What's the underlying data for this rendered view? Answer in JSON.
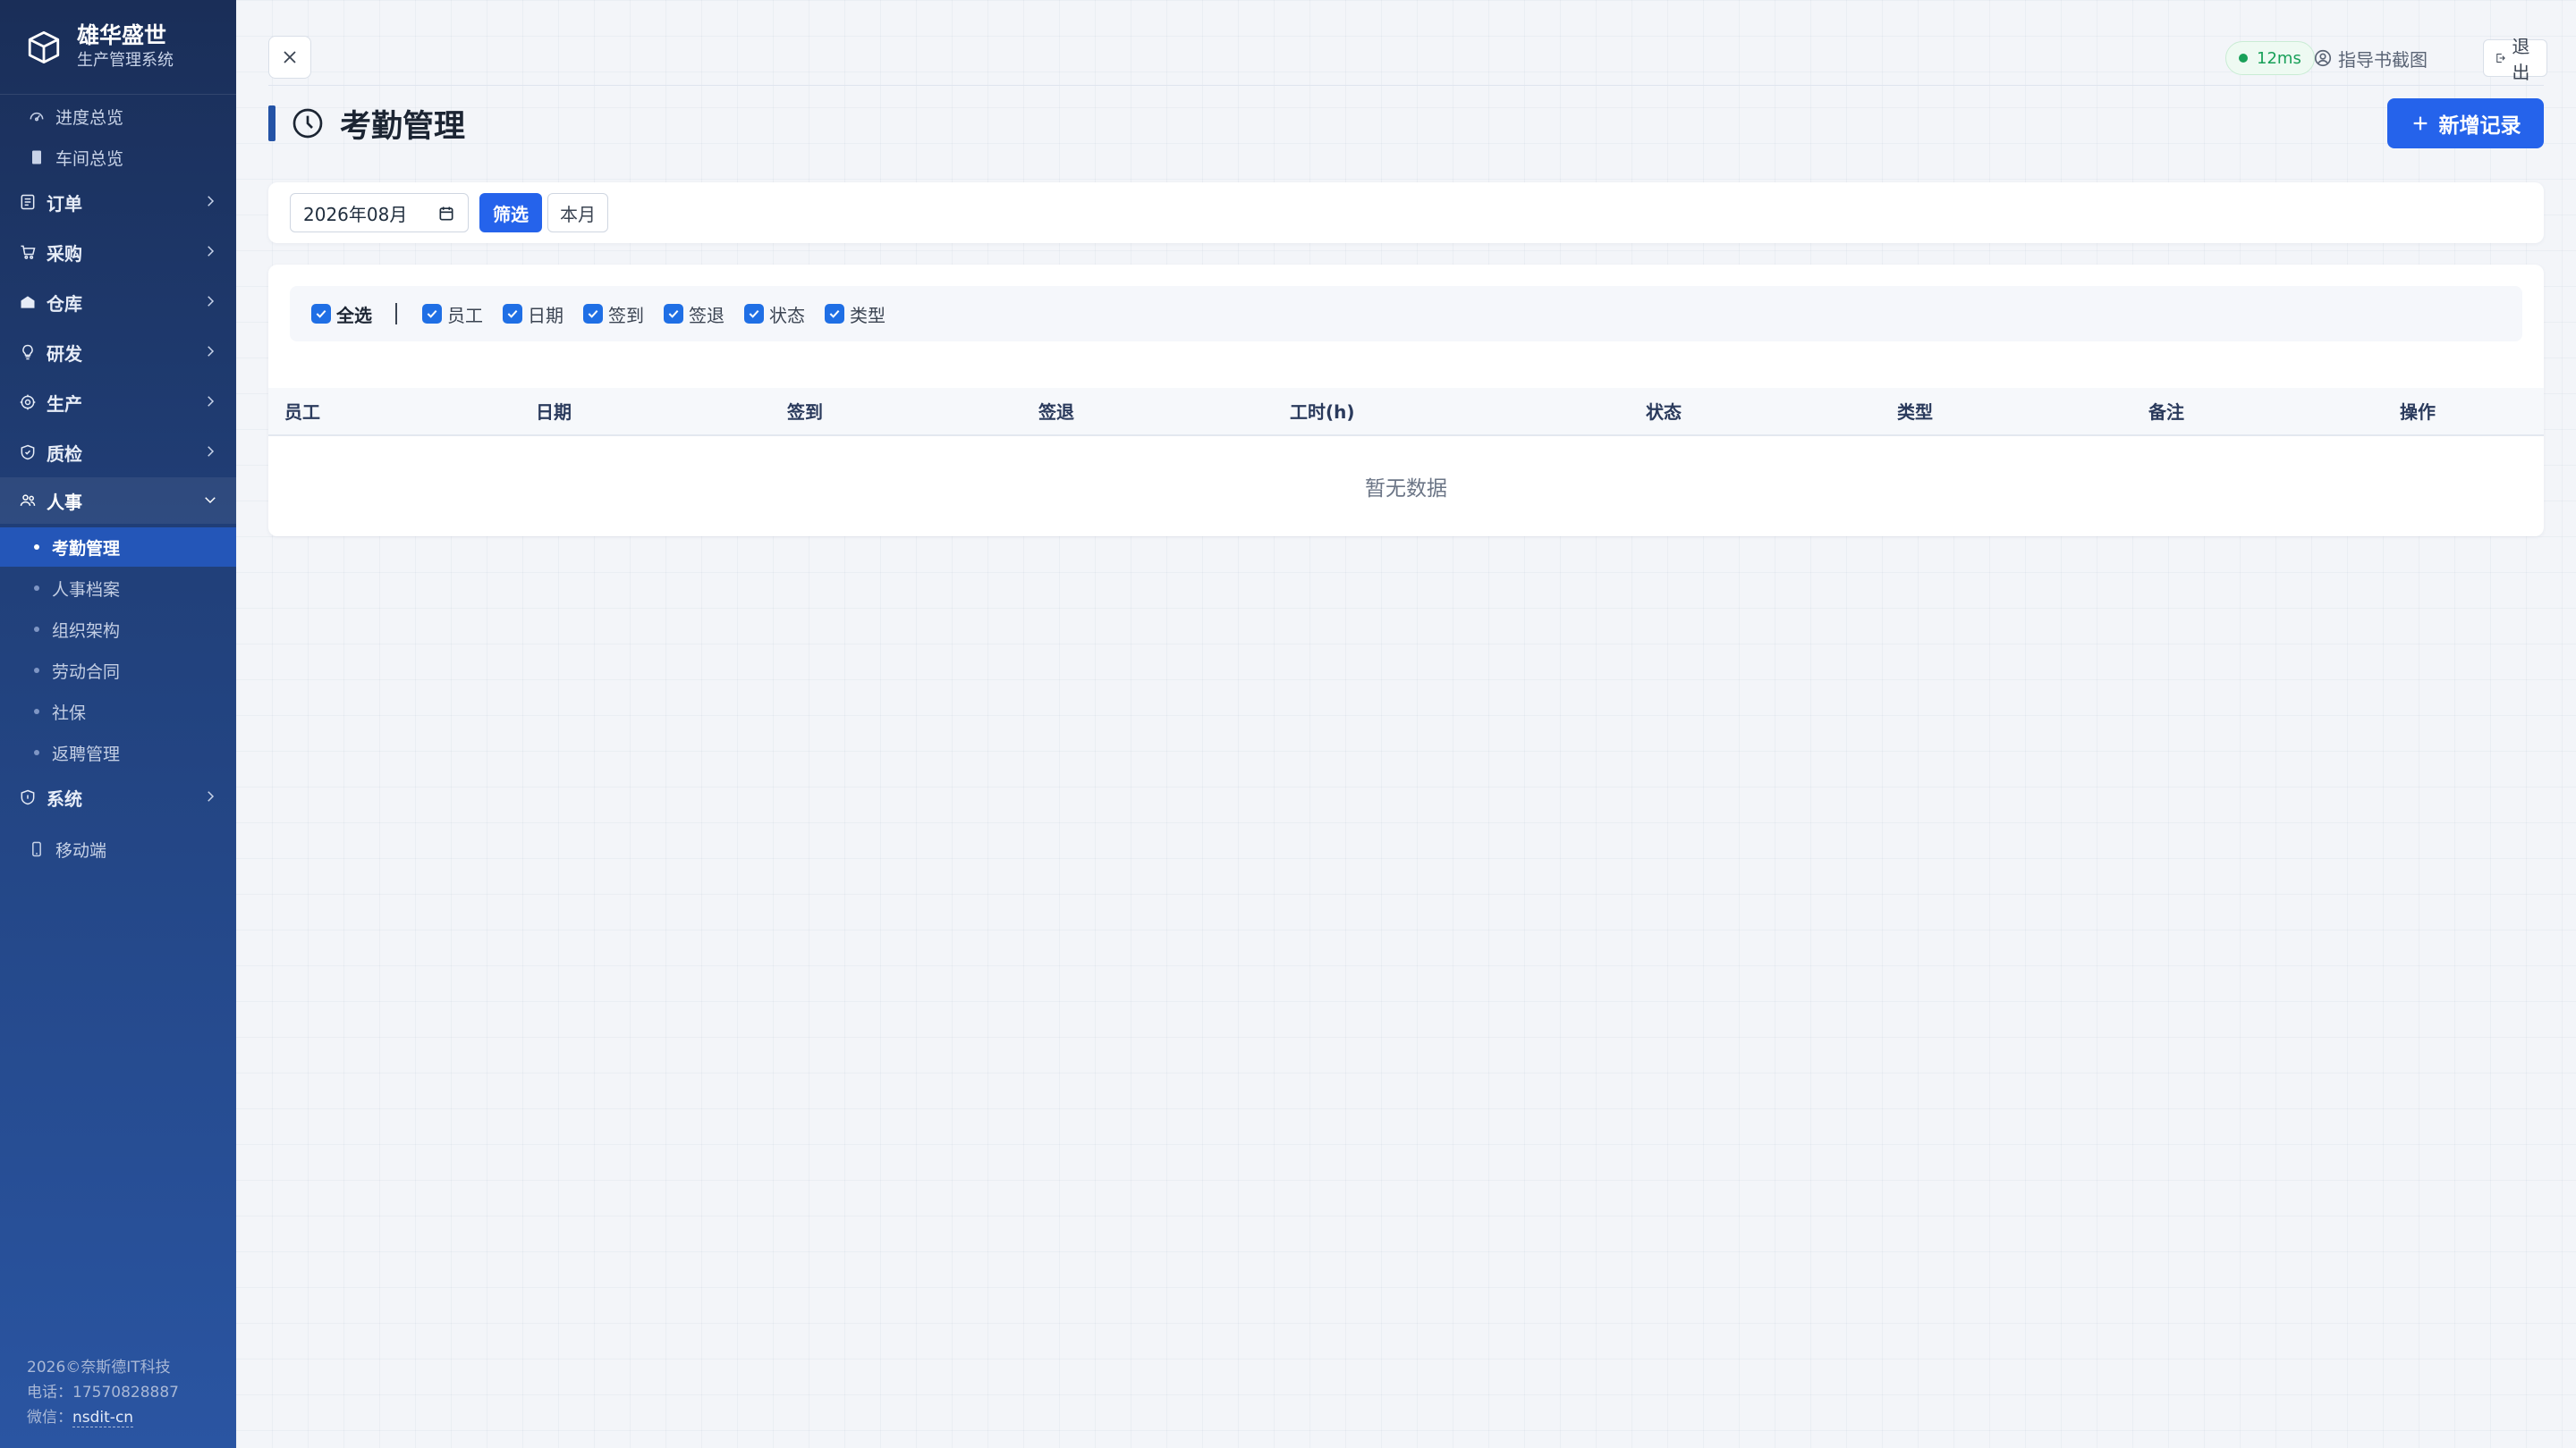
{
  "brand": {
    "title": "雄华盛世",
    "subtitle": "生产管理系统"
  },
  "nav": {
    "progress": "进度总览",
    "workshop": "车间总览",
    "orders": "订单",
    "purchase": "采购",
    "warehouse": "仓库",
    "rnd": "研发",
    "production": "生产",
    "quality": "质检",
    "hr": "人事",
    "hr_items": [
      "考勤管理",
      "人事档案",
      "组织架构",
      "劳动合同",
      "社保",
      "返聘管理"
    ],
    "system": "系统",
    "mobile": "移动端"
  },
  "footer": {
    "copyright": "2026©奈斯德IT科技",
    "phone": "电话：17570828887",
    "wechat_label": "微信：",
    "wechat_id": "nsdit-cn"
  },
  "topbar": {
    "latency": "12ms",
    "guide": "指导书截图",
    "logout": "退出"
  },
  "page": {
    "title": "考勤管理",
    "add_button": "新增记录"
  },
  "filter": {
    "month_value": "2026年08月",
    "filter_button": "筛选",
    "this_month_button": "本月"
  },
  "columns_toggle": {
    "select_all": "全选",
    "items": [
      "员工",
      "日期",
      "签到",
      "签退",
      "状态",
      "类型"
    ]
  },
  "table": {
    "headers": [
      "员工",
      "日期",
      "签到",
      "签退",
      "工时(h)",
      "状态",
      "类型",
      "备注",
      "操作"
    ],
    "empty_text": "暂无数据"
  },
  "colors": {
    "accent": "#2563eb",
    "sidebar_active": "#2456b8",
    "online": "#18a058"
  }
}
